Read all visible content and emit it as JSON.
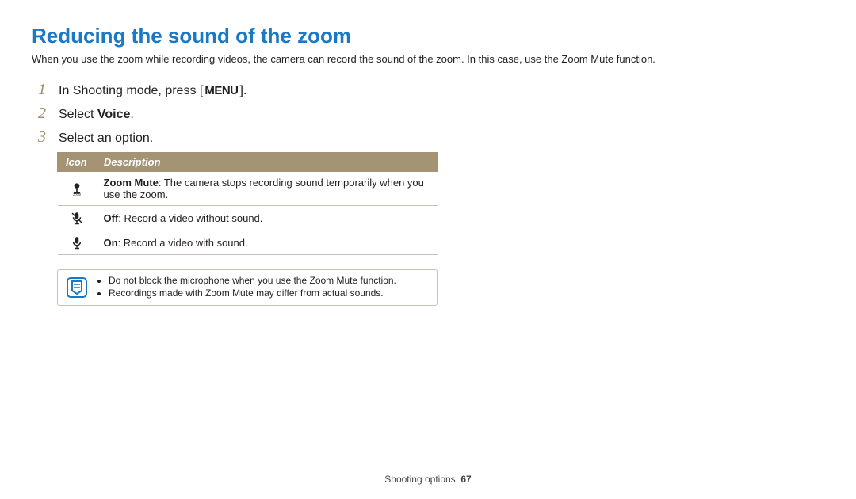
{
  "title": "Reducing the sound of the zoom",
  "intro": "When you use the zoom while recording videos, the camera can record the sound of the zoom. In this case, use the Zoom Mute function.",
  "steps": {
    "s1_pre": "In Shooting mode, press [",
    "s1_menu": "Menu",
    "s1_post": "].",
    "s2_pre": "Select ",
    "s2_bold": "Voice",
    "s2_post": ".",
    "s3": "Select an option."
  },
  "table": {
    "header_icon": "Icon",
    "header_desc": "Description",
    "rows": [
      {
        "icon": "zoom-mute",
        "bold": "Zoom Mute",
        "text": ": The camera stops recording sound temporarily when you use the zoom."
      },
      {
        "icon": "mic-off",
        "bold": "Off",
        "text": ": Record a video without sound."
      },
      {
        "icon": "mic-on",
        "bold": "On",
        "text": ": Record a video with sound."
      }
    ]
  },
  "notes": [
    "Do not block the microphone when you use the Zoom Mute function.",
    "Recordings made with Zoom Mute may differ from actual sounds."
  ],
  "footer_section": "Shooting options",
  "footer_page": "67"
}
